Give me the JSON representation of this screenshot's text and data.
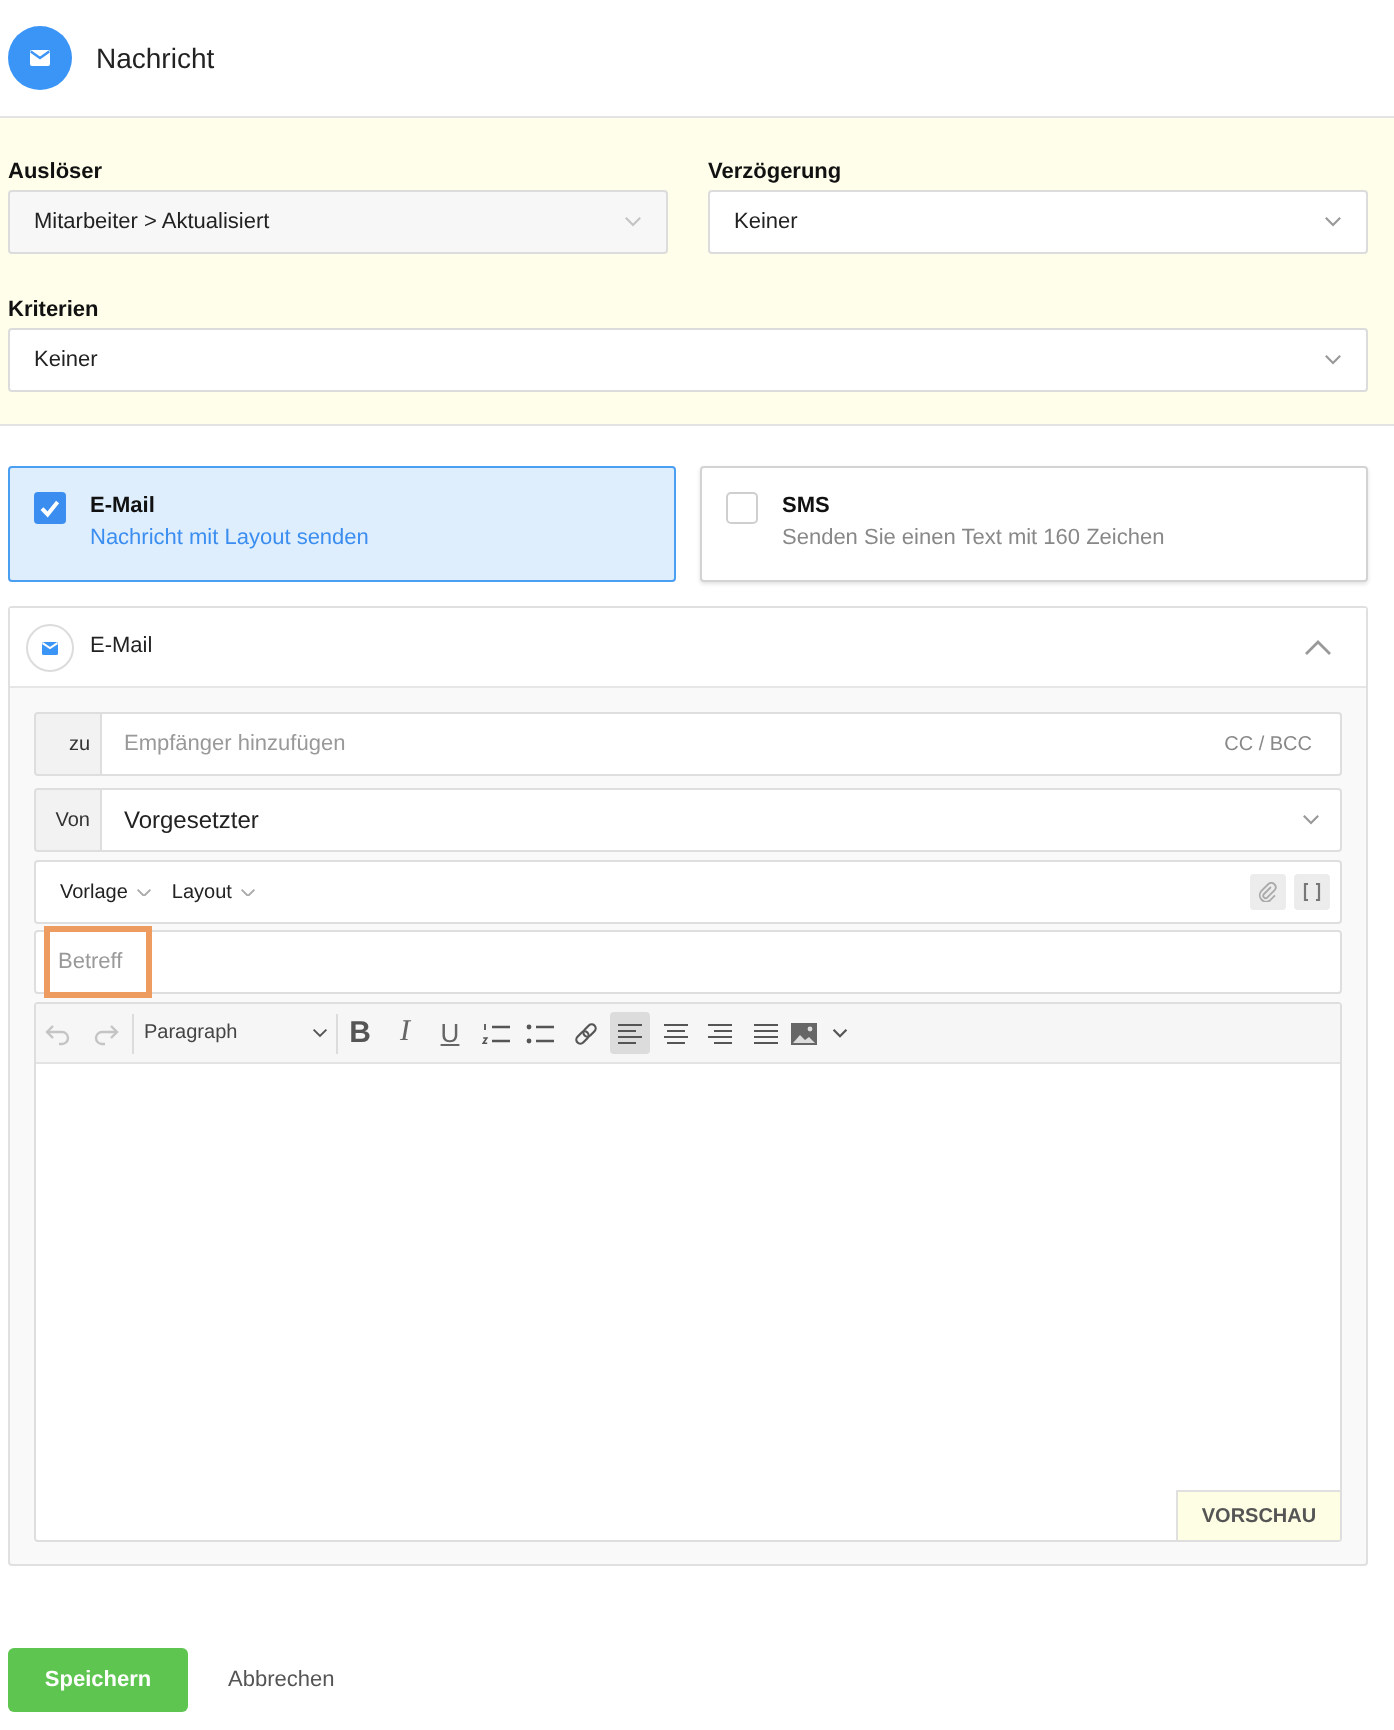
{
  "header": {
    "title": "Nachricht"
  },
  "settings": {
    "fields": [
      {
        "label": "Auslöser",
        "value": "Mitarbeiter > Aktualisiert",
        "disabled": true
      },
      {
        "label": "Verzögerung",
        "value": "Keiner",
        "disabled": false
      },
      {
        "label": "Kriterien",
        "value": "Keiner",
        "disabled": false
      }
    ]
  },
  "channels": [
    {
      "title": "E-Mail",
      "description": "Nachricht mit Layout senden",
      "checked": true
    },
    {
      "title": "SMS",
      "description": "Senden Sie einen Text mit 160 Zeichen",
      "checked": false
    }
  ],
  "email_panel": {
    "title": "E-Mail",
    "expanded": true,
    "recipients": {
      "label": "zu",
      "placeholder": "Empfänger hinzufügen",
      "cc_bcc": "CC / BCC"
    },
    "sender": {
      "label": "Von",
      "value": "Vorgesetzter"
    },
    "menus": [
      "Vorlage",
      "Layout"
    ],
    "subject": {
      "placeholder": "Betreff",
      "highlighted": true
    },
    "editor": {
      "history": [
        {
          "kind": "undo",
          "disabled": true
        },
        {
          "kind": "redo",
          "disabled": true
        }
      ],
      "block_format": "Paragraph",
      "tools": [
        {
          "kind": "bold",
          "label": "B",
          "active": false
        },
        {
          "kind": "italic",
          "label": "I",
          "active": false
        },
        {
          "kind": "underline",
          "label": "U",
          "active": false
        },
        {
          "kind": "ordered_list",
          "active": false
        },
        {
          "kind": "bullet_list",
          "active": false
        },
        {
          "kind": "link",
          "active": false
        },
        {
          "kind": "align_left",
          "active": true
        },
        {
          "kind": "align_center",
          "active": false
        },
        {
          "kind": "align_right",
          "active": false
        },
        {
          "kind": "align_justify",
          "active": false
        },
        {
          "kind": "image",
          "active": false
        }
      ],
      "preview_button": "VORSCHAU"
    }
  },
  "actions": [
    {
      "label": "Speichern",
      "kind": "primary"
    },
    {
      "label": "Abbrechen",
      "kind": "secondary"
    }
  ]
}
